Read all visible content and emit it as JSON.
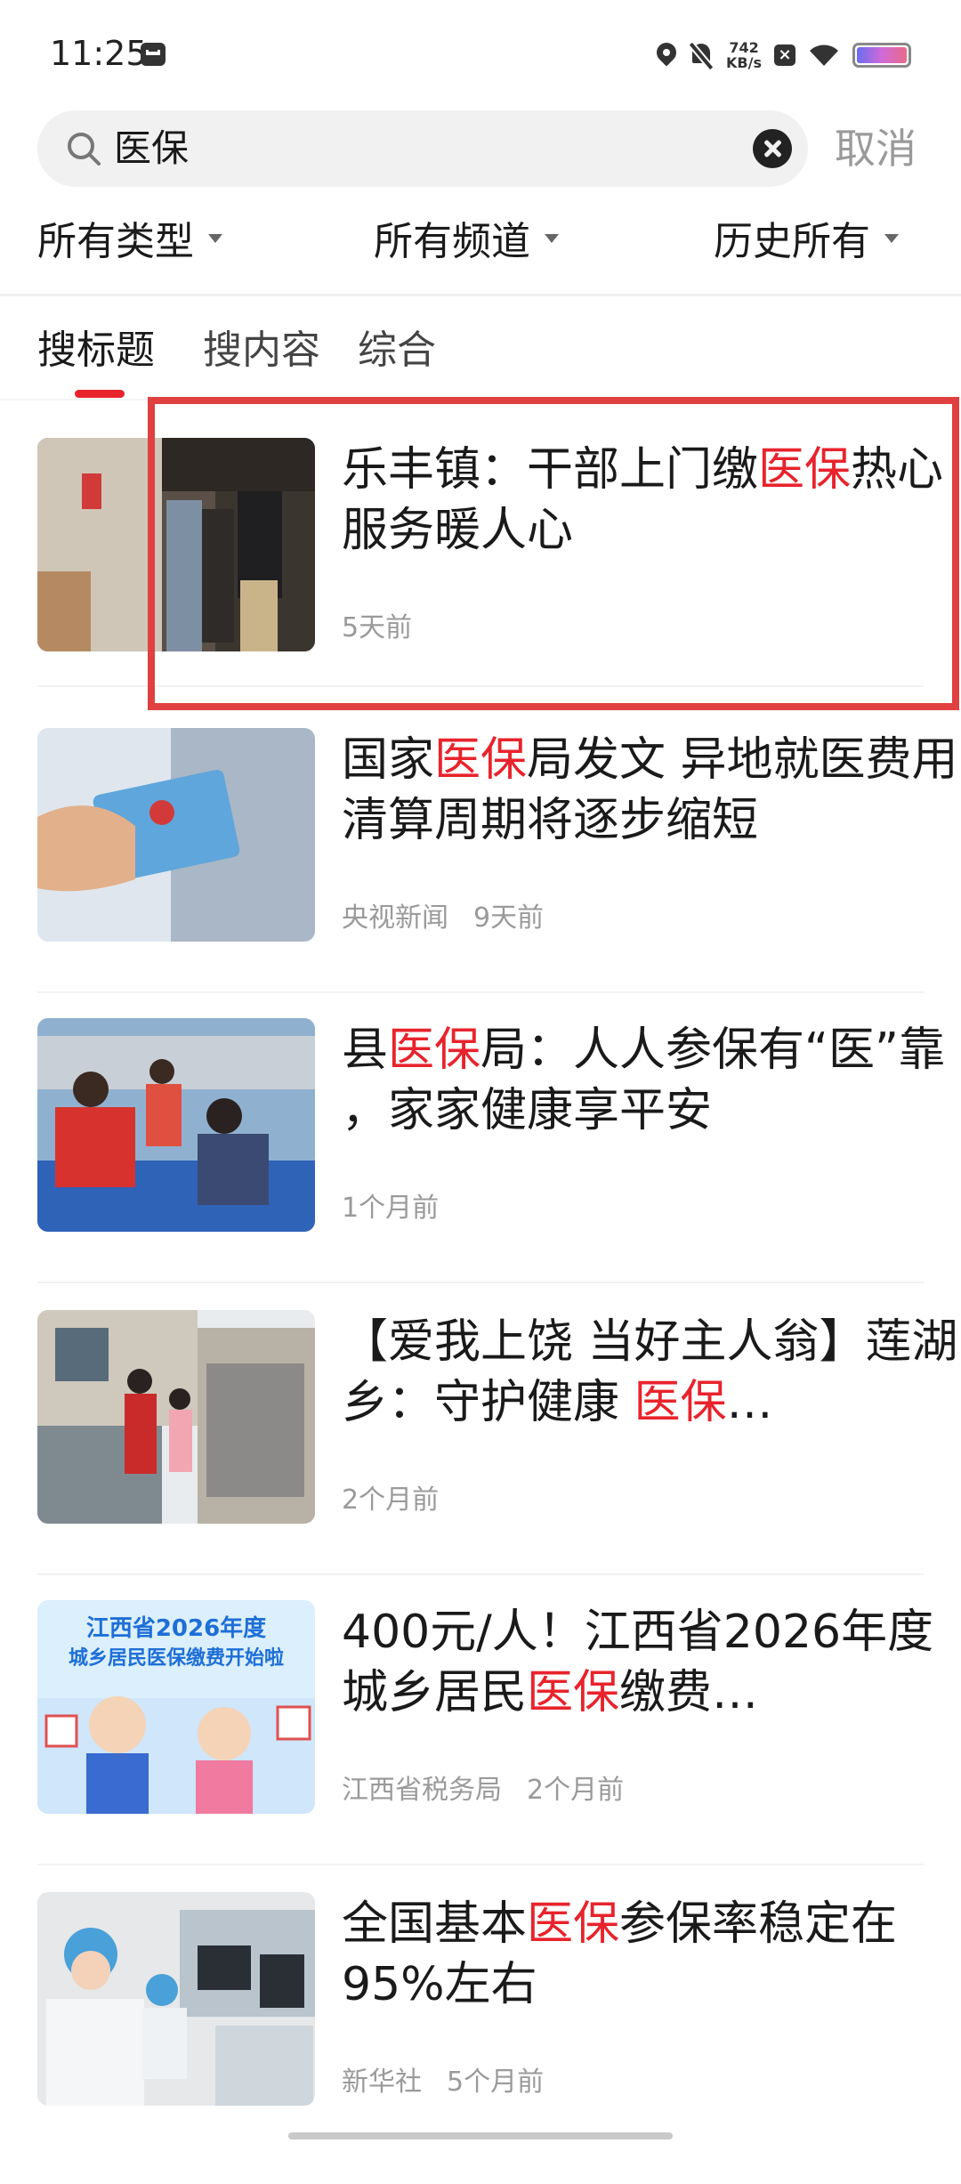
{
  "status_bar": {
    "time": "11:25",
    "speed_value": "742",
    "speed_unit": "KB/s"
  },
  "search": {
    "query": "医保",
    "cancel_label": "取消"
  },
  "filters": [
    {
      "label": "所有类型"
    },
    {
      "label": "所有频道"
    },
    {
      "label": "历史所有"
    }
  ],
  "tabs": [
    {
      "label": "搜标题",
      "active": true
    },
    {
      "label": "搜内容",
      "active": false
    },
    {
      "label": "综合",
      "active": false
    }
  ],
  "news": [
    {
      "title_parts": [
        "乐丰镇：干部上门缴",
        "医保",
        "热心服务暖人心"
      ],
      "meta": [
        "5天前"
      ],
      "thumb_icon": "door-visit-photo"
    },
    {
      "title_parts": [
        "国家",
        "医保",
        "局发文 异地就医费用清算周期将逐步缩短"
      ],
      "meta": [
        "央视新闻",
        "9天前"
      ],
      "thumb_icon": "insurance-card-photo"
    },
    {
      "title_parts": [
        "县",
        "医保",
        "局：人人参保有“医”靠 ，家家健康享平安"
      ],
      "meta": [
        "1个月前"
      ],
      "thumb_icon": "outdoor-service-desk-photo"
    },
    {
      "title_parts": [
        "【爱我上饶 当好主人翁】莲湖乡：守护健康 ",
        "医保",
        "…"
      ],
      "meta": [
        "2个月前"
      ],
      "thumb_icon": "village-gate-photo"
    },
    {
      "title_parts": [
        "400元/人！江西省2026年度城乡居民",
        "医保",
        "缴费…"
      ],
      "meta": [
        "江西省税务局",
        "2个月前"
      ],
      "thumb_icon": "cartoon-poster",
      "thumb_text": [
        "江西省2026年度",
        "城乡居民医保缴费开始啦"
      ]
    },
    {
      "title_parts": [
        "全国基本",
        "医保",
        "参保率稳定在95%左右"
      ],
      "meta": [
        "新华社",
        "5个月前"
      ],
      "thumb_icon": "hospital-nurse-photo"
    }
  ],
  "colors": {
    "highlight": "#e8232c",
    "annotation_box": "#e04040"
  }
}
